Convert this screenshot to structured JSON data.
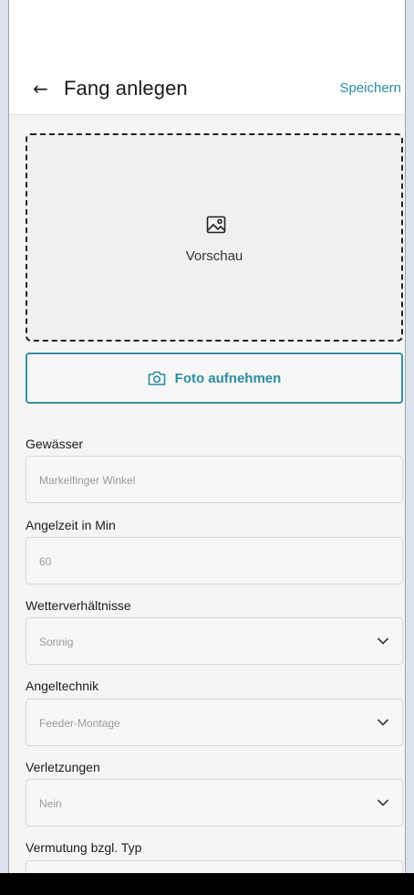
{
  "header": {
    "title": "Fang anlegen",
    "save_label": "Speichern"
  },
  "preview": {
    "label": "Vorschau"
  },
  "photo_button": {
    "label": "Foto aufnehmen"
  },
  "fields": [
    {
      "label": "Gewässer",
      "value": "Markelfinger Winkel",
      "type": "input"
    },
    {
      "label": "Angelzeit in Min",
      "value": "60",
      "type": "input"
    },
    {
      "label": "Wetterverhältnisse",
      "value": "Sonnig",
      "type": "select"
    },
    {
      "label": "Angeltechnik",
      "value": "Feeder-Montage",
      "type": "select"
    },
    {
      "label": "Verletzungen",
      "value": "Nein",
      "type": "select"
    },
    {
      "label": "Vermutung bzgl. Typ",
      "value": "",
      "type": "select"
    }
  ],
  "colors": {
    "accent": "#2a8da0",
    "background": "#f5f5f5"
  }
}
